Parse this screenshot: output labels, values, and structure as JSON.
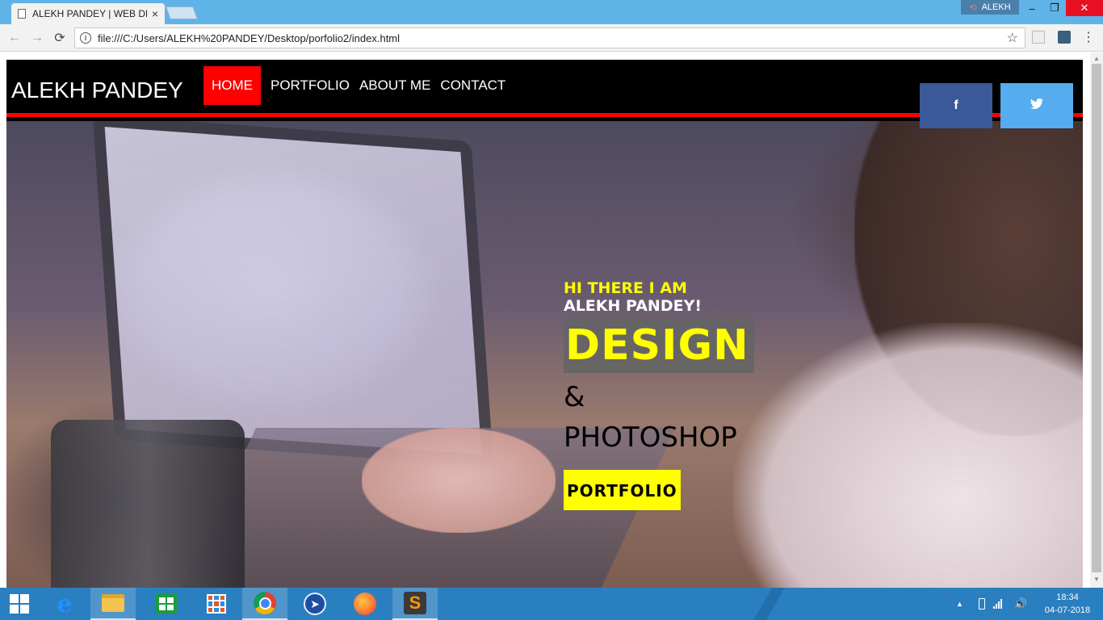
{
  "browser": {
    "tab_title": "ALEKH PANDEY | WEB DE",
    "tab_close": "×",
    "user_name": "ALEKH",
    "window_min": "–",
    "window_max": "❐",
    "window_close": "✕",
    "nav_back": "←",
    "nav_forward": "→",
    "nav_reload": "⟳",
    "url": "file:///C:/Users/ALEKH%20PANDEY/Desktop/porfolio2/index.html",
    "info": "i",
    "star": "☆",
    "menu": "⋮"
  },
  "site": {
    "brand": "ALEKH PANDEY",
    "nav": [
      "HOME",
      "PORTFOLIO",
      "ABOUT ME",
      "CONTACT"
    ],
    "social": {
      "facebook": "f",
      "twitter": "🐦"
    },
    "hero": {
      "greeting": "HI THERE I AM",
      "name": "ALEKH PANDEY!",
      "headline": "DESIGN",
      "ampersand": "&",
      "subline": "PHOTOSHOP",
      "button": "PORTFOLIO"
    }
  },
  "taskbar": {
    "time": "18:34",
    "date": "04-07-2018",
    "tray_up": "▲",
    "volume": "🔊",
    "compass": "➤",
    "sublime": "S",
    "ie": "e"
  },
  "colors": {
    "accent_red": "#ff0000",
    "hero_yellow": "#ffff00",
    "facebook": "#3b5998",
    "twitter": "#55acee",
    "taskbar": "#2a7fc0"
  }
}
